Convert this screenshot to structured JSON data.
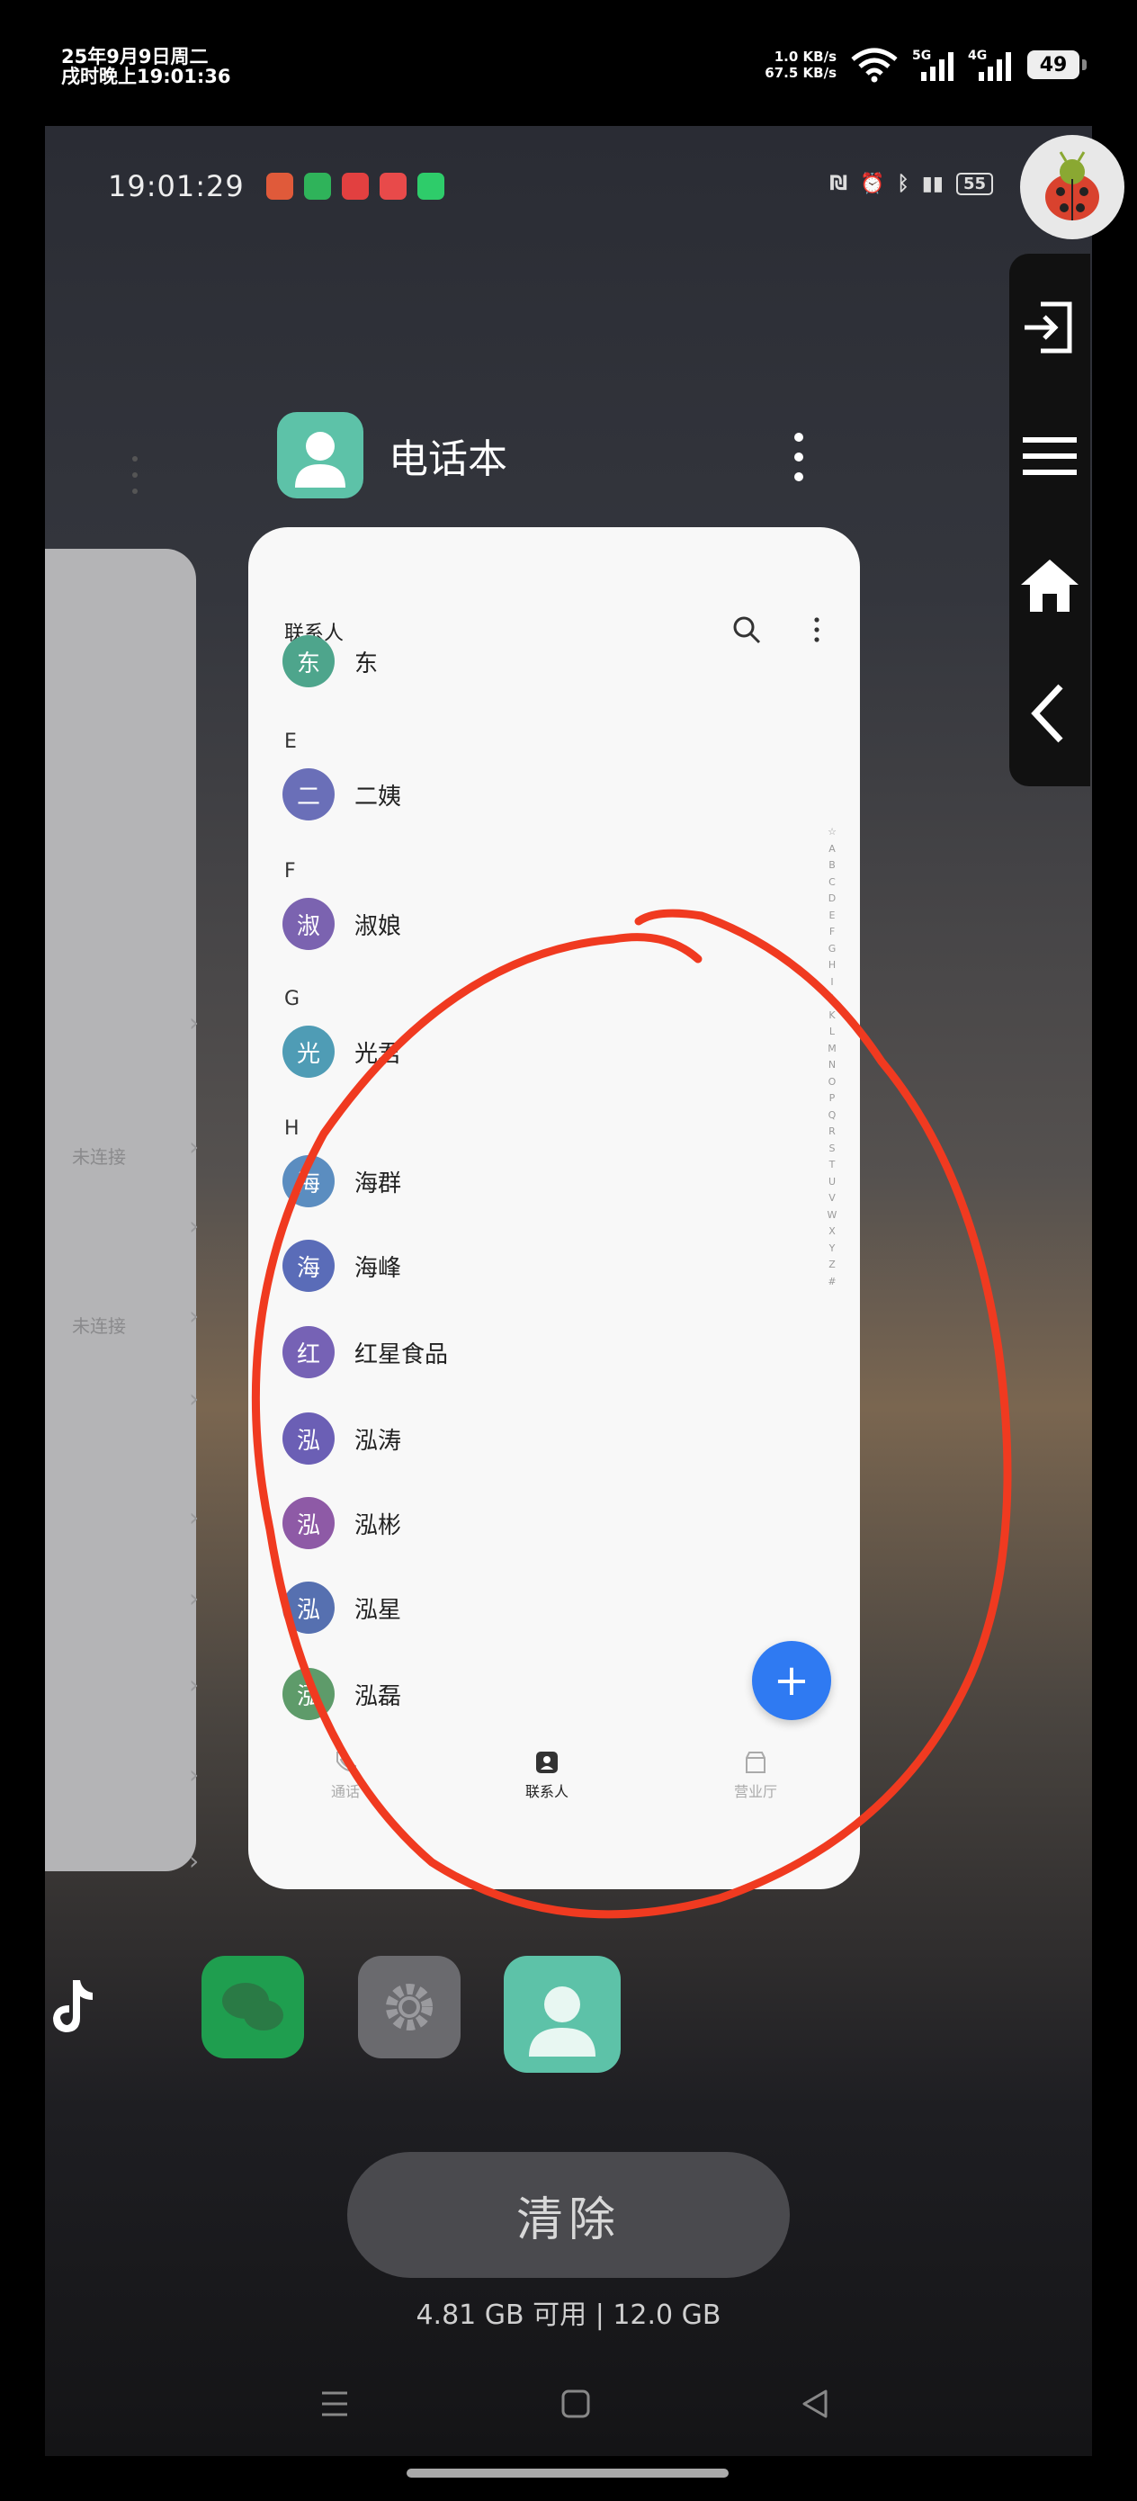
{
  "status_bar": {
    "date": "25年9月9日周二",
    "time_line": "戌时晚上19:01:36",
    "upload_speed": "1.0 KB/s",
    "download_speed": "67.5 KB/s",
    "wifi_label": "6",
    "net1": "5G",
    "net2": "4G",
    "battery": "49"
  },
  "inner_status": {
    "time": "19:01:29",
    "battery": "55"
  },
  "card": {
    "app_name": "电话本",
    "header_title": "联系人",
    "sections": [
      {
        "letter": "E",
        "contacts": [
          {
            "avatar": "二",
            "name": "二姨",
            "color": "#6a6fb8"
          }
        ]
      },
      {
        "letter": "F",
        "contacts": [
          {
            "avatar": "淑",
            "name": "淑娘",
            "color": "#7b63b0"
          }
        ]
      },
      {
        "letter": "G",
        "contacts": [
          {
            "avatar": "光",
            "name": "光君",
            "color": "#4f9cb5"
          }
        ]
      },
      {
        "letter": "H",
        "contacts": [
          {
            "avatar": "海",
            "name": "海群",
            "color": "#5b8dc0"
          },
          {
            "avatar": "海",
            "name": "海峰",
            "color": "#5a6cb8"
          },
          {
            "avatar": "红",
            "name": "红星食品",
            "color": "#7662b5"
          },
          {
            "avatar": "泓",
            "name": "泓涛",
            "color": "#6b5fb5"
          },
          {
            "avatar": "泓",
            "name": "泓彬",
            "color": "#8e5aa6"
          },
          {
            "avatar": "泓",
            "name": "泓星",
            "color": "#5670b0"
          },
          {
            "avatar": "泓",
            "name": "泓磊",
            "color": "#5e9b6a"
          }
        ]
      }
    ],
    "partial_top": {
      "avatar": "东",
      "name": "东",
      "color": "#4ea58c"
    },
    "alpha": [
      "☆",
      "A",
      "B",
      "C",
      "D",
      "E",
      "F",
      "G",
      "H",
      "I",
      "J",
      "K",
      "L",
      "M",
      "N",
      "O",
      "P",
      "Q",
      "R",
      "S",
      "T",
      "U",
      "V",
      "W",
      "X",
      "Y",
      "Z",
      "#"
    ],
    "tabs": [
      {
        "label": "通话",
        "icon": "phone-icon"
      },
      {
        "label": "联系人",
        "icon": "contacts-icon"
      },
      {
        "label": "营业厅",
        "icon": "store-icon"
      }
    ],
    "fab": "+"
  },
  "prev_card": {
    "items": [
      "未连接",
      "未连接"
    ]
  },
  "clear_button": "清除",
  "memory": "4.81 GB 可用 | 12.0 GB",
  "colors": {
    "accent": "#2f7af2",
    "annotation": "#f03a20",
    "app_icon": "#5dc2a8"
  }
}
